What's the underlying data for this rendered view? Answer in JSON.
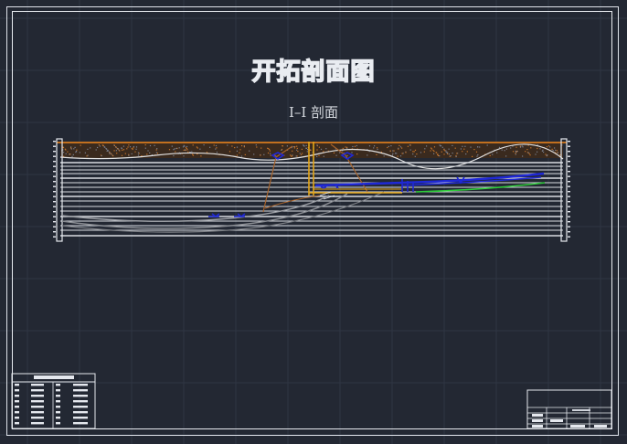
{
  "drawing": {
    "title": "开拓剖面图",
    "subtitle": "I–I 剖面"
  },
  "colors": {
    "background": "#232833",
    "grid": "#2f3643",
    "frame": "#e5e8ee",
    "strata": "#d9dce2",
    "topsoil": "#b4641c",
    "shaft": "#e3a418",
    "roadway_blue": "#1f28d6",
    "roadway_green": "#2ecc3a",
    "old_workings": "#9a9da3"
  }
}
